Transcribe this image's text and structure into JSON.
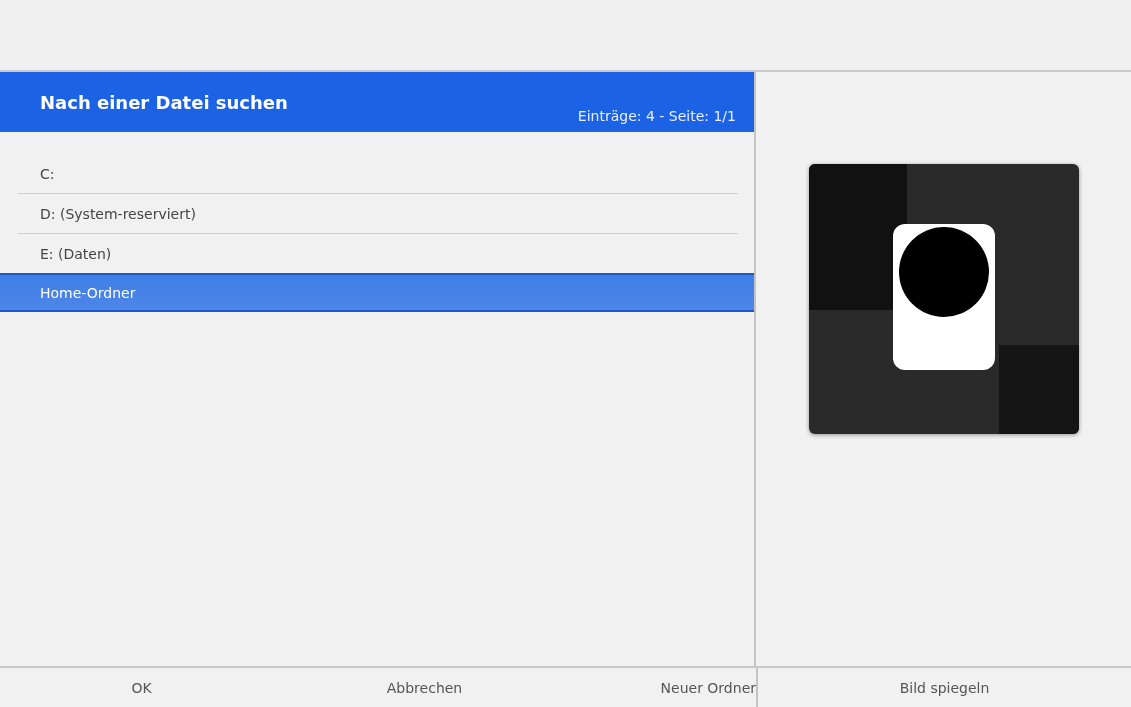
{
  "dialog": {
    "title": "Nach einer Datei suchen",
    "info": "Einträge: 4 - Seite: 1/1"
  },
  "items": [
    {
      "label": "C:",
      "selected": false
    },
    {
      "label": "D: (System-reserviert)",
      "selected": false
    },
    {
      "label": "E: (Daten)",
      "selected": false
    },
    {
      "label": "Home-Ordner",
      "selected": true
    }
  ],
  "buttons": [
    "OK",
    "Abbrechen",
    "Neuer Ordner"
  ],
  "preview_button": "Bild spiegeln"
}
